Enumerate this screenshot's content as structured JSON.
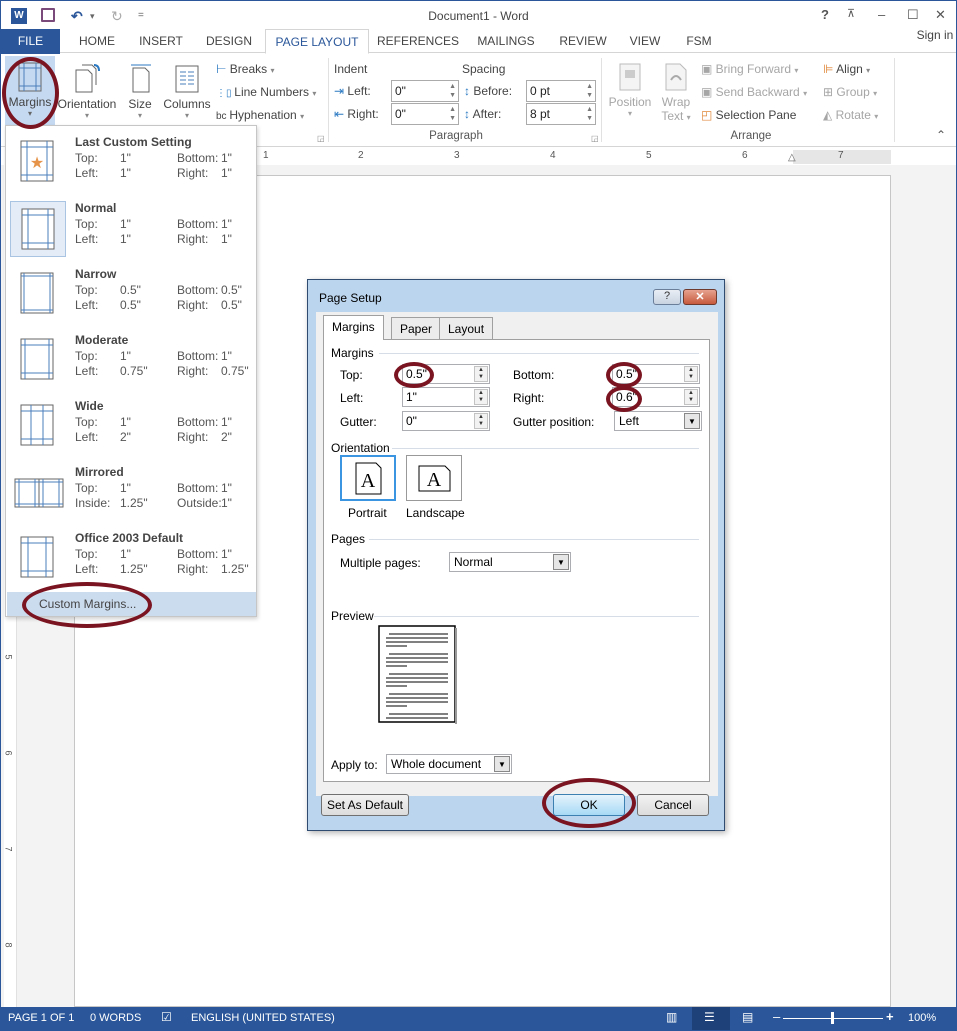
{
  "window": {
    "title": "Document1 - Word",
    "controls": {
      "help": "?",
      "ribbon_display": "⊼",
      "minimize": "–",
      "maximize": "☐",
      "close": "✕"
    },
    "sign_in": "Sign in"
  },
  "quick_access": {
    "word_icon": "W",
    "save": "save-icon",
    "undo": "↶",
    "undo_dropdown": "▾",
    "redo": "↻",
    "customize": "="
  },
  "tabs": [
    {
      "label": "FILE"
    },
    {
      "label": "HOME"
    },
    {
      "label": "INSERT"
    },
    {
      "label": "DESIGN"
    },
    {
      "label": "PAGE LAYOUT",
      "active": true
    },
    {
      "label": "REFERENCES"
    },
    {
      "label": "MAILINGS"
    },
    {
      "label": "REVIEW"
    },
    {
      "label": "VIEW"
    },
    {
      "label": "FSM"
    }
  ],
  "ribbon": {
    "page_setup": {
      "margins": "Margins",
      "orientation": "Orientation",
      "size": "Size",
      "columns": "Columns",
      "breaks": "Breaks",
      "line_numbers": "Line Numbers",
      "hyphenation": "Hyphenation",
      "dropdown": "▾"
    },
    "paragraph": {
      "group_label": "Paragraph",
      "indent_label": "Indent",
      "spacing_label": "Spacing",
      "left_label": "Left:",
      "left_value": "0\"",
      "right_label": "Right:",
      "right_value": "0\"",
      "before_label": "Before:",
      "before_value": "0 pt",
      "after_label": "After:",
      "after_value": "8 pt"
    },
    "arrange": {
      "group_label": "Arrange",
      "position": "Position",
      "wrap": "Wrap",
      "wrap_text": "Text",
      "bring_forward": "Bring Forward",
      "send_backward": "Send Backward",
      "selection_pane": "Selection Pane",
      "align": "Align",
      "group": "Group",
      "rotate": "Rotate"
    },
    "collapse": "⌃"
  },
  "ruler": {
    "h_numbers": [
      "1",
      "2",
      "3",
      "4",
      "5",
      "6",
      "7"
    ],
    "v_numbers": [
      "5",
      "6",
      "7",
      "8"
    ]
  },
  "margins_menu": {
    "items": [
      {
        "name": "Last Custom Setting",
        "l1": "Top:",
        "v1": "1\"",
        "l2": "Bottom:",
        "v2": "1\"",
        "l3": "Left:",
        "v3": "1\"",
        "l4": "Right:",
        "v4": "1\""
      },
      {
        "name": "Normal",
        "l1": "Top:",
        "v1": "1\"",
        "l2": "Bottom:",
        "v2": "1\"",
        "l3": "Left:",
        "v3": "1\"",
        "l4": "Right:",
        "v4": "1\""
      },
      {
        "name": "Narrow",
        "l1": "Top:",
        "v1": "0.5\"",
        "l2": "Bottom:",
        "v2": "0.5\"",
        "l3": "Left:",
        "v3": "0.5\"",
        "l4": "Right:",
        "v4": "0.5\""
      },
      {
        "name": "Moderate",
        "l1": "Top:",
        "v1": "1\"",
        "l2": "Bottom:",
        "v2": "1\"",
        "l3": "Left:",
        "v3": "0.75\"",
        "l4": "Right:",
        "v4": "0.75\""
      },
      {
        "name": "Wide",
        "l1": "Top:",
        "v1": "1\"",
        "l2": "Bottom:",
        "v2": "1\"",
        "l3": "Left:",
        "v3": "2\"",
        "l4": "Right:",
        "v4": "2\""
      },
      {
        "name": "Mirrored",
        "l1": "Top:",
        "v1": "1\"",
        "l2": "Bottom:",
        "v2": "1\"",
        "l3": "Inside:",
        "v3": "1.25\"",
        "l4": "Outside:",
        "v4": "1\""
      },
      {
        "name": "Office 2003 Default",
        "l1": "Top:",
        "v1": "1\"",
        "l2": "Bottom:",
        "v2": "1\"",
        "l3": "Left:",
        "v3": "1.25\"",
        "l4": "Right:",
        "v4": "1.25\""
      }
    ],
    "custom": "Custom Margins..."
  },
  "dialog": {
    "title": "Page Setup",
    "help": "?",
    "close": "✕",
    "tabs": [
      "Margins",
      "Paper",
      "Layout"
    ],
    "margins_section": "Margins",
    "top_label": "Top:",
    "top_value": "0.5\"",
    "bottom_label": "Bottom:",
    "bottom_value": "0.5\"",
    "left_label": "Left:",
    "left_value": "1\"",
    "right_label": "Right:",
    "right_value": "0.6\"",
    "gutter_label": "Gutter:",
    "gutter_value": "0\"",
    "gutter_pos_label": "Gutter position:",
    "gutter_pos_value": "Left",
    "orientation_section": "Orientation",
    "portrait": "Portrait",
    "landscape": "Landscape",
    "orientation_glyph": "A",
    "pages_section": "Pages",
    "multiple_pages_label": "Multiple pages:",
    "multiple_pages_value": "Normal",
    "preview_section": "Preview",
    "apply_to_label": "Apply to:",
    "apply_to_value": "Whole document",
    "set_default": "Set As Default",
    "ok": "OK",
    "cancel": "Cancel"
  },
  "status_bar": {
    "page": "PAGE 1 OF 1",
    "words": "0 WORDS",
    "language": "ENGLISH (UNITED STATES)",
    "zoom": "100%",
    "zoom_minus": "–",
    "zoom_plus": "+"
  }
}
